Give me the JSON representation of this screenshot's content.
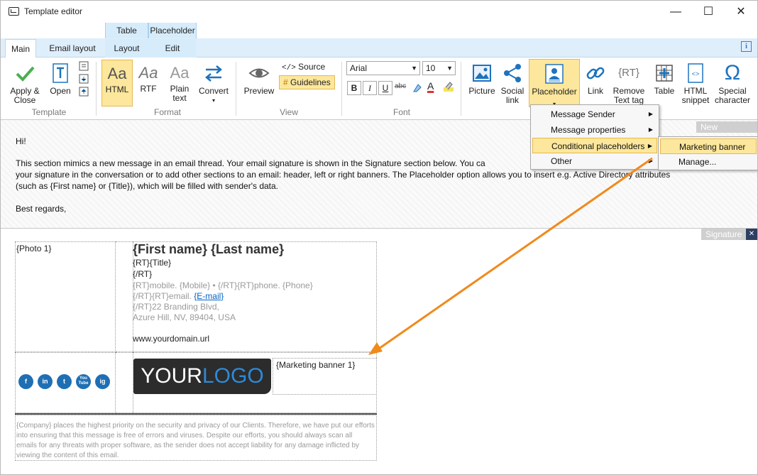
{
  "window": {
    "title": "Template editor",
    "minimize": "—",
    "maximize": "☐",
    "close": "✕"
  },
  "context_tabs": {
    "table": "Table",
    "placeholder": "Placeholder"
  },
  "tabs": [
    {
      "label": "Main",
      "active": true
    },
    {
      "label": "Email layout"
    },
    {
      "label": "Layout"
    },
    {
      "label": "Edit"
    }
  ],
  "info_label": "i",
  "ribbon": {
    "template": {
      "group": "Template",
      "apply_close": "Apply &\nClose",
      "open": "Open"
    },
    "format": {
      "group": "Format",
      "html": "HTML",
      "rtf": "RTF",
      "plain_text": "Plain\ntext",
      "convert": "Convert",
      "html_glyph": "Aa",
      "rtf_glyph": "Aa",
      "plain_glyph": "Aa"
    },
    "view": {
      "group": "View",
      "preview": "Preview",
      "source": "Source",
      "guidelines": "Guidelines"
    },
    "font": {
      "group": "Font",
      "family": "Arial",
      "size": "10",
      "bold": "B",
      "italic": "I",
      "underline": "U",
      "strike": "abc",
      "color": "A"
    },
    "insert": {
      "picture": "Picture",
      "social_link": "Social\nlink",
      "placeholder": "Placeholder",
      "link": "Link",
      "remove_text_tag": "Remove\nText tag",
      "table": "Table",
      "html_snippet": "HTML\nsnippet",
      "special_character": "Special\ncharacter",
      "rt_glyph": "{RT}",
      "omega": "Ω",
      "dropdown": "▾"
    }
  },
  "menu": {
    "items": [
      "Message Sender",
      "Message properties",
      "Conditional placeholders",
      "Other"
    ],
    "submenu": [
      "Marketing banner",
      "Manage..."
    ],
    "arrow": "▶"
  },
  "editor": {
    "label": "New message",
    "greeting": "Hi!",
    "line1": "This section mimics a new message in an email thread. Your email signature is shown in the Signature section below. You ca",
    "line2": "your signature in the conversation or to add other sections to an email: header, left or right banners. The Placeholder option allows you to insert e.g. Active Directory attributes",
    "line3": "(such as {First name} or {Title}), which will be filled with sender's data.",
    "closing": "Best regards,"
  },
  "signature": {
    "label": "Signature",
    "close": "✕",
    "photo": "{Photo 1}",
    "name": "{First name} {Last name}",
    "title_line": "{RT}{Title}",
    "rt_end": "{/RT}",
    "contact_line": "{RT}mobile. {Mobile} • {/RT}{RT}phone. {Phone}",
    "email_prefix": "{/RT}{RT}email. ",
    "email_link": "{E-mail}",
    "address1": "{/RT}22 Branding Blvd,",
    "address2": "Azure Hill, NV, 89404, USA",
    "website": "www.yourdomain.url",
    "logo_your": "YOUR",
    "logo_logo": "LOGO",
    "banner": "{Marketing banner 1}",
    "social": [
      "f",
      "in",
      "t",
      "You\nTube",
      "ig"
    ],
    "disclaimer": "{Company} places the highest priority on the security and privacy of our Clients. Therefore, we have put our efforts into ensuring that this message is free of errors and viruses. Despite our efforts, you should always scan all emails for any threats with proper software, as the sender does not accept liability for any damage inflicted by viewing the content of this email."
  },
  "colors": {
    "accent": "#f08a1c",
    "selected": "#fde79c",
    "link": "#0563c1",
    "social": "#1f6fb4"
  }
}
